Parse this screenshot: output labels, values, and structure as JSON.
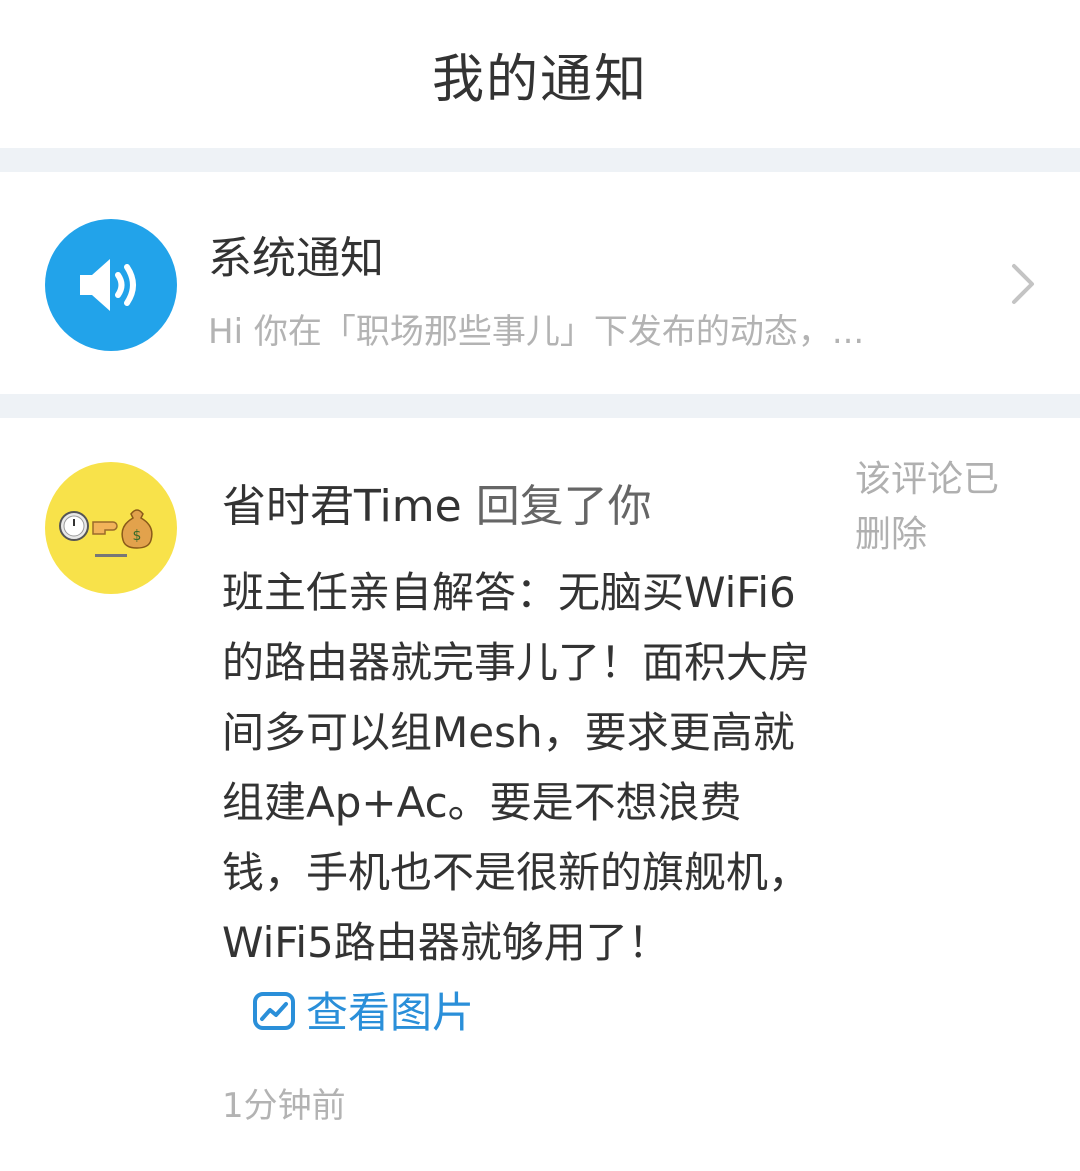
{
  "header": {
    "title": "我的通知"
  },
  "system_notice": {
    "icon": "speaker-icon",
    "title": "系统通知",
    "preview": "Hi 你在「职场那些事儿」下发布的动态，..."
  },
  "notifications": [
    {
      "avatar_icon": "clock-hand-moneybag-icon",
      "user": "省时君Time",
      "action": "回复了你",
      "deleted_note": "该评论已删除",
      "body": "班主任亲自解答：无脑买WiFi6的路由器就完事儿了！面积大房间多可以组Mesh，要求更高就组建Ap+Ac。要是不想浪费钱，手机也不是很新的旗舰机，WiFi5路由器就够用了！",
      "view_image_label": "查看图片",
      "time": "1分钟前"
    }
  ],
  "colors": {
    "accent_blue": "#22a3ea",
    "link_blue": "#2a8fd9",
    "avatar_yellow": "#f8e24a",
    "divider": "#eef2f6"
  }
}
